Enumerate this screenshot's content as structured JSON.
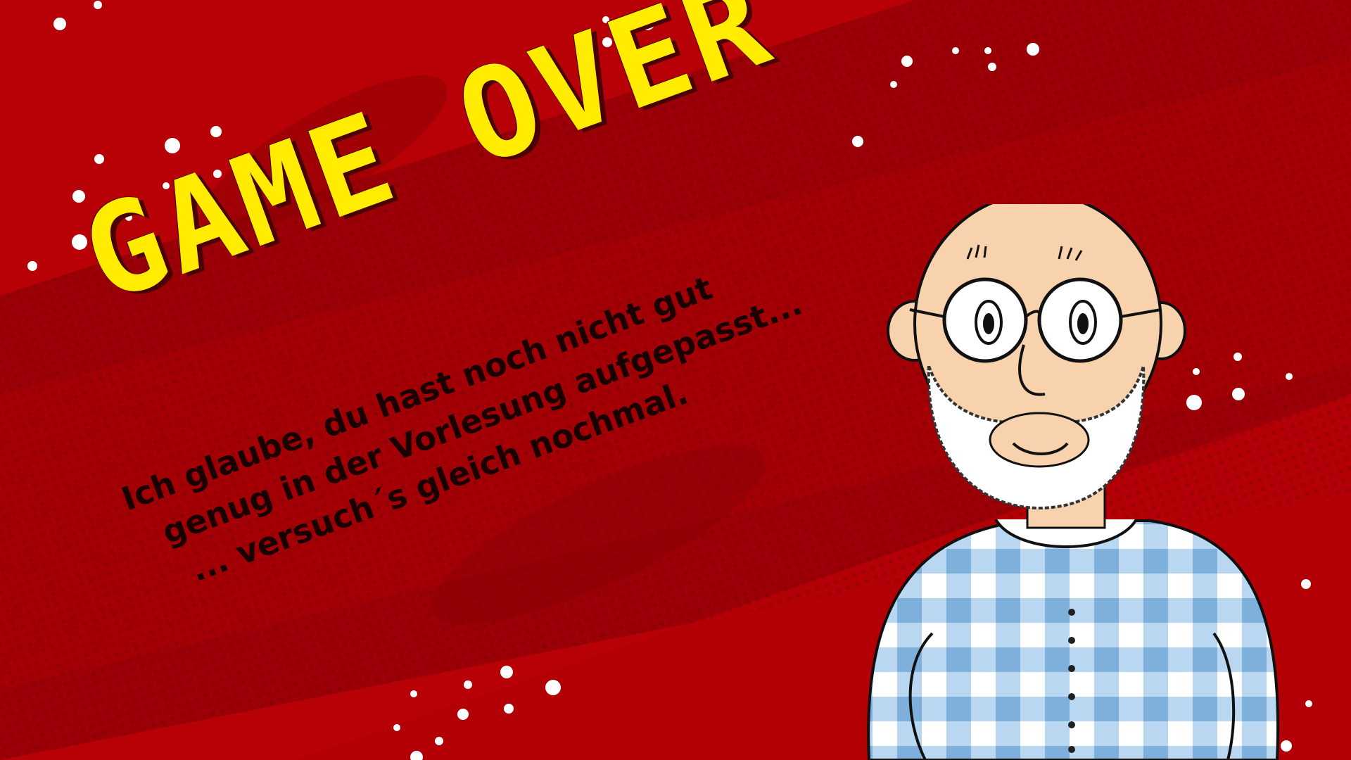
{
  "game_over_screen": {
    "title": "GAME OVER",
    "message_lines": [
      "Ich glaube, du hast noch nicht gut",
      "genug in der Vorlesung aufgepasst...",
      "... versuch´s gleich nochmal."
    ],
    "character": "bald bearded man with round glasses in blue plaid shirt"
  },
  "colors": {
    "background": "#b80007",
    "title": "#ffec00",
    "message": "#1a0000",
    "shirt": "#9ec8f0"
  }
}
